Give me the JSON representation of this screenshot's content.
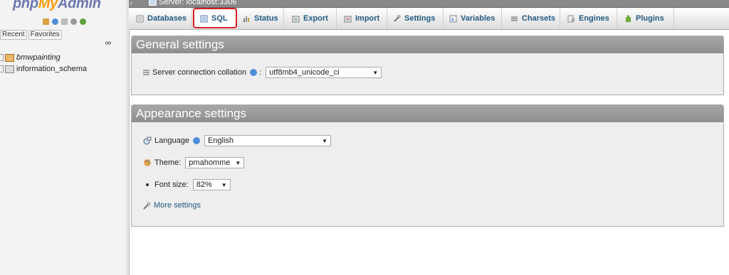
{
  "nav": {
    "logo": {
      "php": "php",
      "my": "My",
      "admin": "Admin"
    },
    "recent_label": "Recent",
    "favorites_label": "Favorites",
    "databases": [
      {
        "name": "bmwpainting",
        "italic": true
      },
      {
        "name": "information_schema",
        "italic": false
      }
    ]
  },
  "serverbar": {
    "server": "Server: localhost:3306"
  },
  "tabs": [
    {
      "label": "Databases",
      "icon": "databases-icon"
    },
    {
      "label": "SQL",
      "icon": "sql-icon",
      "highlighted": true
    },
    {
      "label": "Status",
      "icon": "status-icon"
    },
    {
      "label": "Export",
      "icon": "export-icon"
    },
    {
      "label": "Import",
      "icon": "import-icon"
    },
    {
      "label": "Settings",
      "icon": "wrench-icon"
    },
    {
      "label": "Variables",
      "icon": "variables-icon"
    },
    {
      "label": "Charsets",
      "icon": "charsets-icon"
    },
    {
      "label": "Engines",
      "icon": "engines-icon"
    },
    {
      "label": "Plugins",
      "icon": "plugins-icon"
    }
  ],
  "general": {
    "title": "General settings",
    "collation_label": "Server connection collation",
    "collation_value": "utf8mb4_unicode_ci"
  },
  "appearance": {
    "title": "Appearance settings",
    "language_label": "Language",
    "language_value": "English",
    "theme_label": "Theme:",
    "theme_value": "pmahomme",
    "fontsize_label": "Font size:",
    "fontsize_value": "82%",
    "more_settings": "More settings"
  },
  "colors": {
    "accent_red": "#d81e1e",
    "link": "#235a81",
    "legend": "#9a9a9a"
  }
}
